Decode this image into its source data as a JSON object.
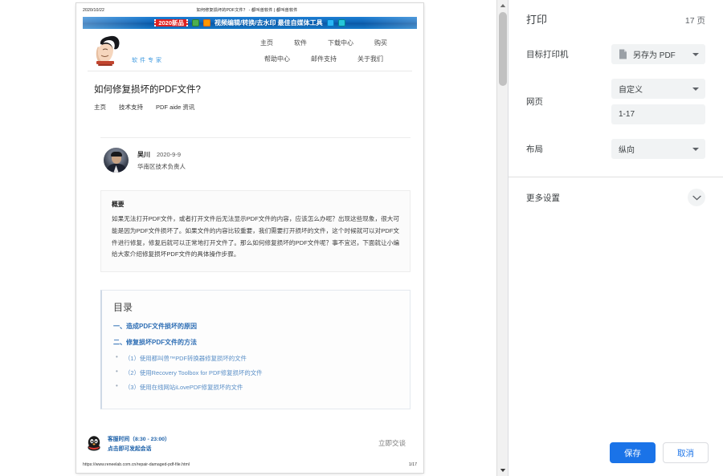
{
  "preview": {
    "header": {
      "date": "2020/10/22",
      "doc_title": "如何修复损坏的PDF文件？ - 都叫兽软件 | 都叫兽软件"
    },
    "ad": {
      "badge": "2020新品",
      "text": "视频编辑/转换/去水印 最佳自媒体工具"
    },
    "site": {
      "logo_text": "软件专家",
      "nav_row1": [
        "主页",
        "软件",
        "下载中心",
        "购买"
      ],
      "nav_row2": [
        "帮助中心",
        "邮件支持",
        "关于我们"
      ]
    },
    "article": {
      "title": "如何修复损坏的PDF文件?",
      "breadcrumbs": [
        "主页",
        "技术支持",
        "PDF aide 资讯"
      ],
      "author": {
        "name": "吴川",
        "date": "2020-9-9",
        "role": "华南区技术负责人"
      },
      "summary": {
        "heading": "概要",
        "text": "如果无法打开PDF文件，或者打开文件后无法显示PDF文件的内容，应该怎么办呢？出现这些现象，很大可能是因为PDF文件损坏了。如果文件的内容比较重要，我们需要打开损坏的文件，这个时候就可以对PDF文件进行修复，修复后就可以正常地打开文件了。那么如何修复损坏的PDF文件呢？事不宜迟，下面就让小编给大家介绍修复损坏PDF文件的具体操作步骤。"
      },
      "toc": {
        "title": "目录",
        "section1": "一、造成PDF文件损坏的原因",
        "section2": "二、修复损坏PDF文件的方法",
        "items": [
          "（1）使用都叫兽™PDF转换器修复损坏的文件",
          "（2）使用Recovery Toolbox for PDF修复损坏的文件",
          "（3）使用在线网站iLovePDF修复损坏的文件"
        ]
      }
    },
    "chat": {
      "line1": "客服时间（8:30 - 23:00）",
      "line2": "点击即可发起会话",
      "cta": "立即交谈"
    },
    "footer": {
      "url": "https://www.reneelab.com.cn/repair-damaged-pdf-file.html",
      "page": "1/17"
    }
  },
  "print": {
    "title": "打印",
    "page_count": "17 页",
    "destination": {
      "label": "目标打印机",
      "value": "另存为 PDF"
    },
    "pages": {
      "label": "网页",
      "value": "自定义",
      "range": "1-17"
    },
    "layout": {
      "label": "布局",
      "value": "纵向"
    },
    "more_settings": "更多设置",
    "save_button": "保存",
    "cancel_button": "取消"
  },
  "colors": {
    "accent": "#1a73e8",
    "ad_badge": "#e02020",
    "link": "#2f6fb5",
    "panel_bg": "#f1f3f4"
  }
}
